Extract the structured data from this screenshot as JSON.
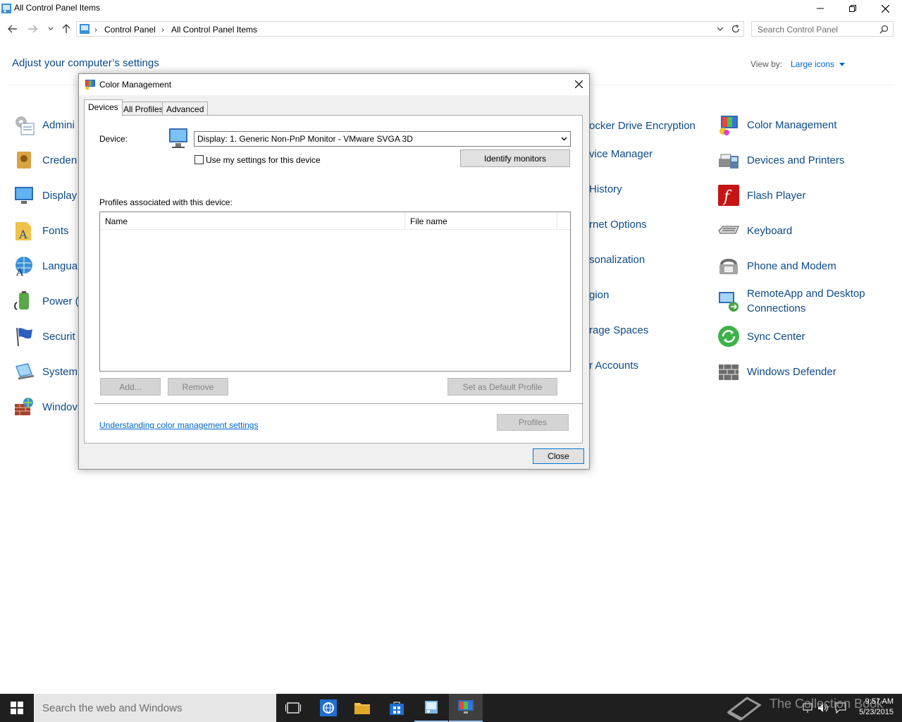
{
  "window": {
    "title": "All Control Panel Items",
    "minimize": "—",
    "restore": "❐",
    "close": "✕"
  },
  "address": {
    "crumbs": [
      "Control Panel",
      "All Control Panel Items"
    ],
    "search_placeholder": "Search Control Panel"
  },
  "header": {
    "title": "Adjust your computer’s settings",
    "view_by_label": "View by:",
    "view_by_value": "Large icons"
  },
  "items_left": [
    {
      "label": "Admini",
      "icon": "admin-tools-icon"
    },
    {
      "label": "Creden",
      "icon": "credential-manager-icon"
    },
    {
      "label": "Display",
      "icon": "display-icon"
    },
    {
      "label": "Fonts",
      "icon": "fonts-icon"
    },
    {
      "label": "Langua",
      "icon": "language-icon"
    },
    {
      "label": "Power (",
      "icon": "power-options-icon"
    },
    {
      "label": "Securit",
      "icon": "security-icon"
    },
    {
      "label": "System",
      "icon": "system-icon"
    },
    {
      "label": "Windov",
      "icon": "firewall-icon"
    }
  ],
  "items_middle": [
    {
      "label": "ocker Drive Encryption"
    },
    {
      "label": "vice Manager"
    },
    {
      "label": " History"
    },
    {
      "label": "rnet Options"
    },
    {
      "label": "sonalization"
    },
    {
      "label": "gion"
    },
    {
      "label": "rage Spaces"
    },
    {
      "label": "r Accounts"
    }
  ],
  "items_right": [
    {
      "label": "Color Management",
      "icon": "color-management-icon"
    },
    {
      "label": "Devices and Printers",
      "icon": "devices-printers-icon"
    },
    {
      "label": "Flash Player",
      "icon": "flash-player-icon"
    },
    {
      "label": "Keyboard",
      "icon": "keyboard-icon"
    },
    {
      "label": "Phone and Modem",
      "icon": "phone-modem-icon"
    },
    {
      "label": "RemoteApp and Desktop Connections",
      "icon": "remoteapp-icon"
    },
    {
      "label": "Sync Center",
      "icon": "sync-center-icon"
    },
    {
      "label": "Windows Defender",
      "icon": "windows-defender-icon"
    }
  ],
  "dialog": {
    "title": "Color Management",
    "close": "✕",
    "tabs": [
      "Devices",
      "All Profiles",
      "Advanced"
    ],
    "device_label": "Device:",
    "device_value": "Display: 1. Generic Non-PnP Monitor - VMware SVGA 3D",
    "use_settings_label": "Use my settings for this device",
    "identify_button": "Identify monitors",
    "profiles_label": "Profiles associated with this device:",
    "columns": [
      "Name",
      "File name"
    ],
    "add_button": "Add...",
    "remove_button": "Remove",
    "default_button": "Set as Default Profile",
    "link": "Understanding color management settings",
    "profiles_button": "Profiles",
    "close_button": "Close"
  },
  "taskbar": {
    "search_placeholder": "Search the web and Windows",
    "time": "9:57 AM",
    "date": "5/23/2015",
    "watermark": "The Collection Book"
  }
}
